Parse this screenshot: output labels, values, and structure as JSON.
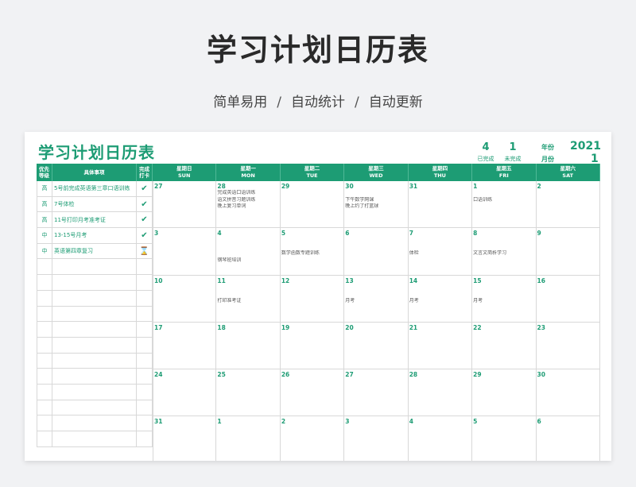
{
  "hero": {
    "title": "学习计划日历表",
    "subtitle_items": [
      "简单易用",
      "自动统计",
      "自动更新"
    ],
    "separator": "/"
  },
  "sheet": {
    "title": "学习计划日历表",
    "stats": {
      "done_count": "4",
      "done_label": "已完成",
      "undone_count": "1",
      "undone_label": "未完成",
      "year_label": "年份",
      "year_value": "2021",
      "month_label": "月份",
      "month_value": "1"
    },
    "left_headers": [
      "优先等级",
      "具体事项",
      "完成打卡"
    ],
    "tasks": [
      {
        "priority": "高",
        "item": "5号前完成英语第三章口语训练",
        "done": true
      },
      {
        "priority": "高",
        "item": "7号体检",
        "done": true
      },
      {
        "priority": "高",
        "item": "11号打印月考准考证",
        "done": true
      },
      {
        "priority": "中",
        "item": "13-15号月考",
        "done": true
      },
      {
        "priority": "中",
        "item": "英语第四章复习",
        "done": false
      },
      {
        "priority": "",
        "item": "",
        "done": null
      },
      {
        "priority": "",
        "item": "",
        "done": null
      },
      {
        "priority": "",
        "item": "",
        "done": null
      },
      {
        "priority": "",
        "item": "",
        "done": null
      },
      {
        "priority": "",
        "item": "",
        "done": null
      },
      {
        "priority": "",
        "item": "",
        "done": null
      },
      {
        "priority": "",
        "item": "",
        "done": null
      },
      {
        "priority": "",
        "item": "",
        "done": null
      },
      {
        "priority": "",
        "item": "",
        "done": null
      },
      {
        "priority": "",
        "item": "",
        "done": null
      },
      {
        "priority": "",
        "item": "",
        "done": null
      },
      {
        "priority": "",
        "item": "",
        "done": null
      }
    ],
    "weekdays": [
      {
        "cn": "星期日",
        "en": "SUN"
      },
      {
        "cn": "星期一",
        "en": "MON"
      },
      {
        "cn": "星期二",
        "en": "TUE"
      },
      {
        "cn": "星期三",
        "en": "WED"
      },
      {
        "cn": "星期四",
        "en": "THU"
      },
      {
        "cn": "星期五",
        "en": "FRI"
      },
      {
        "cn": "星期六",
        "en": "SAT"
      }
    ],
    "weeks": [
      [
        {
          "day": "27",
          "notes": []
        },
        {
          "day": "28",
          "notes": [
            "完成英语口语训练",
            "语文拼音习题训练",
            "晚上复习单词"
          ]
        },
        {
          "day": "29",
          "notes": []
        },
        {
          "day": "30",
          "notes": [
            "",
            "下午数学网课",
            "晚上约了打篮球"
          ]
        },
        {
          "day": "31",
          "notes": []
        },
        {
          "day": "1",
          "notes": [
            "",
            "口语训练"
          ]
        },
        {
          "day": "2",
          "notes": []
        }
      ],
      [
        {
          "day": "3",
          "notes": []
        },
        {
          "day": "4",
          "notes": [
            "",
            "",
            "",
            "钢琴班培训"
          ]
        },
        {
          "day": "5",
          "notes": [
            "",
            "",
            "数学函数专题训练"
          ]
        },
        {
          "day": "6",
          "notes": []
        },
        {
          "day": "7",
          "notes": [
            "",
            "",
            "体检"
          ]
        },
        {
          "day": "8",
          "notes": [
            "",
            "",
            "文言文简析学习"
          ]
        },
        {
          "day": "9",
          "notes": []
        }
      ],
      [
        {
          "day": "10",
          "notes": []
        },
        {
          "day": "11",
          "notes": [
            "",
            "",
            "打印准考证"
          ]
        },
        {
          "day": "12",
          "notes": []
        },
        {
          "day": "13",
          "notes": [
            "",
            "",
            "月考"
          ]
        },
        {
          "day": "14",
          "notes": [
            "",
            "",
            "月考"
          ]
        },
        {
          "day": "15",
          "notes": [
            "",
            "",
            "月考"
          ]
        },
        {
          "day": "16",
          "notes": []
        }
      ],
      [
        {
          "day": "17",
          "notes": []
        },
        {
          "day": "18",
          "notes": []
        },
        {
          "day": "19",
          "notes": []
        },
        {
          "day": "20",
          "notes": []
        },
        {
          "day": "21",
          "notes": []
        },
        {
          "day": "22",
          "notes": []
        },
        {
          "day": "23",
          "notes": []
        }
      ],
      [
        {
          "day": "24",
          "notes": []
        },
        {
          "day": "25",
          "notes": []
        },
        {
          "day": "26",
          "notes": []
        },
        {
          "day": "27",
          "notes": []
        },
        {
          "day": "28",
          "notes": []
        },
        {
          "day": "29",
          "notes": []
        },
        {
          "day": "30",
          "notes": []
        }
      ],
      [
        {
          "day": "31",
          "notes": []
        },
        {
          "day": "1",
          "notes": []
        },
        {
          "day": "2",
          "notes": []
        },
        {
          "day": "3",
          "notes": []
        },
        {
          "day": "4",
          "notes": []
        },
        {
          "day": "5",
          "notes": []
        },
        {
          "day": "6",
          "notes": []
        }
      ]
    ],
    "icons": {
      "done": "check-icon",
      "pending": "hourglass-icon"
    },
    "accent_color": "#1d9c74",
    "pending_color": "#e0a020"
  }
}
